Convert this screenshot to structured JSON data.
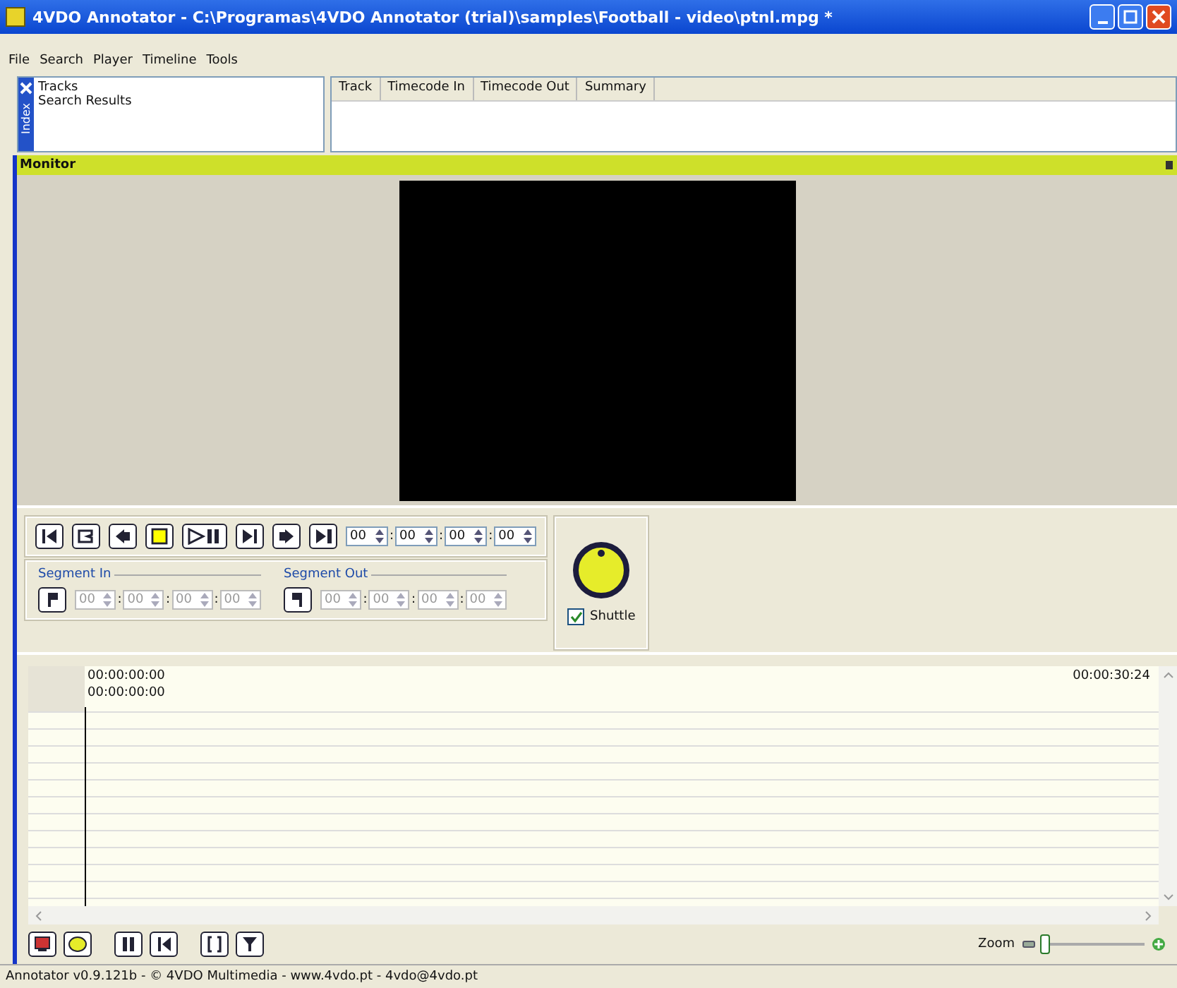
{
  "window": {
    "title": "4VDO Annotator - C:\\Programas\\4VDO Annotator (trial)\\samples\\Football - video\\ptnl.mpg *"
  },
  "menu": [
    "File",
    "Search",
    "Player",
    "Timeline",
    "Tools"
  ],
  "index_panel": {
    "tab_label": "Index",
    "items": [
      "Tracks",
      "Search Results"
    ]
  },
  "table": {
    "columns": [
      "Track",
      "Timecode In",
      "Timecode Out",
      "Summary"
    ]
  },
  "monitor": {
    "title": "Monitor"
  },
  "player": {
    "fields": [
      "00",
      "00",
      "00",
      "00"
    ],
    "separators": [
      ":",
      ":",
      ":"
    ]
  },
  "segment_in": {
    "label": "Segment In",
    "disabled": true,
    "fields": [
      "00",
      "00",
      "00",
      "00"
    ],
    "separators": [
      ":",
      ":",
      ":"
    ]
  },
  "segment_out": {
    "label": "Segment Out",
    "disabled": true,
    "fields": [
      "00",
      "00",
      "00",
      "00"
    ],
    "separators": [
      ":",
      ":",
      ":"
    ]
  },
  "shuttle": {
    "label": "Shuttle",
    "checked": true
  },
  "timeline": {
    "start_top": "00:00:00:00",
    "start_bottom": "00:00:00:00",
    "end": "00:00:30:24",
    "zoom": {
      "label": "Zoom",
      "level": 0.02
    }
  },
  "status_bar": "Annotator v0.9.121b - © 4VDO Multimedia - www.4vdo.pt - 4vdo@4vdo.pt"
}
